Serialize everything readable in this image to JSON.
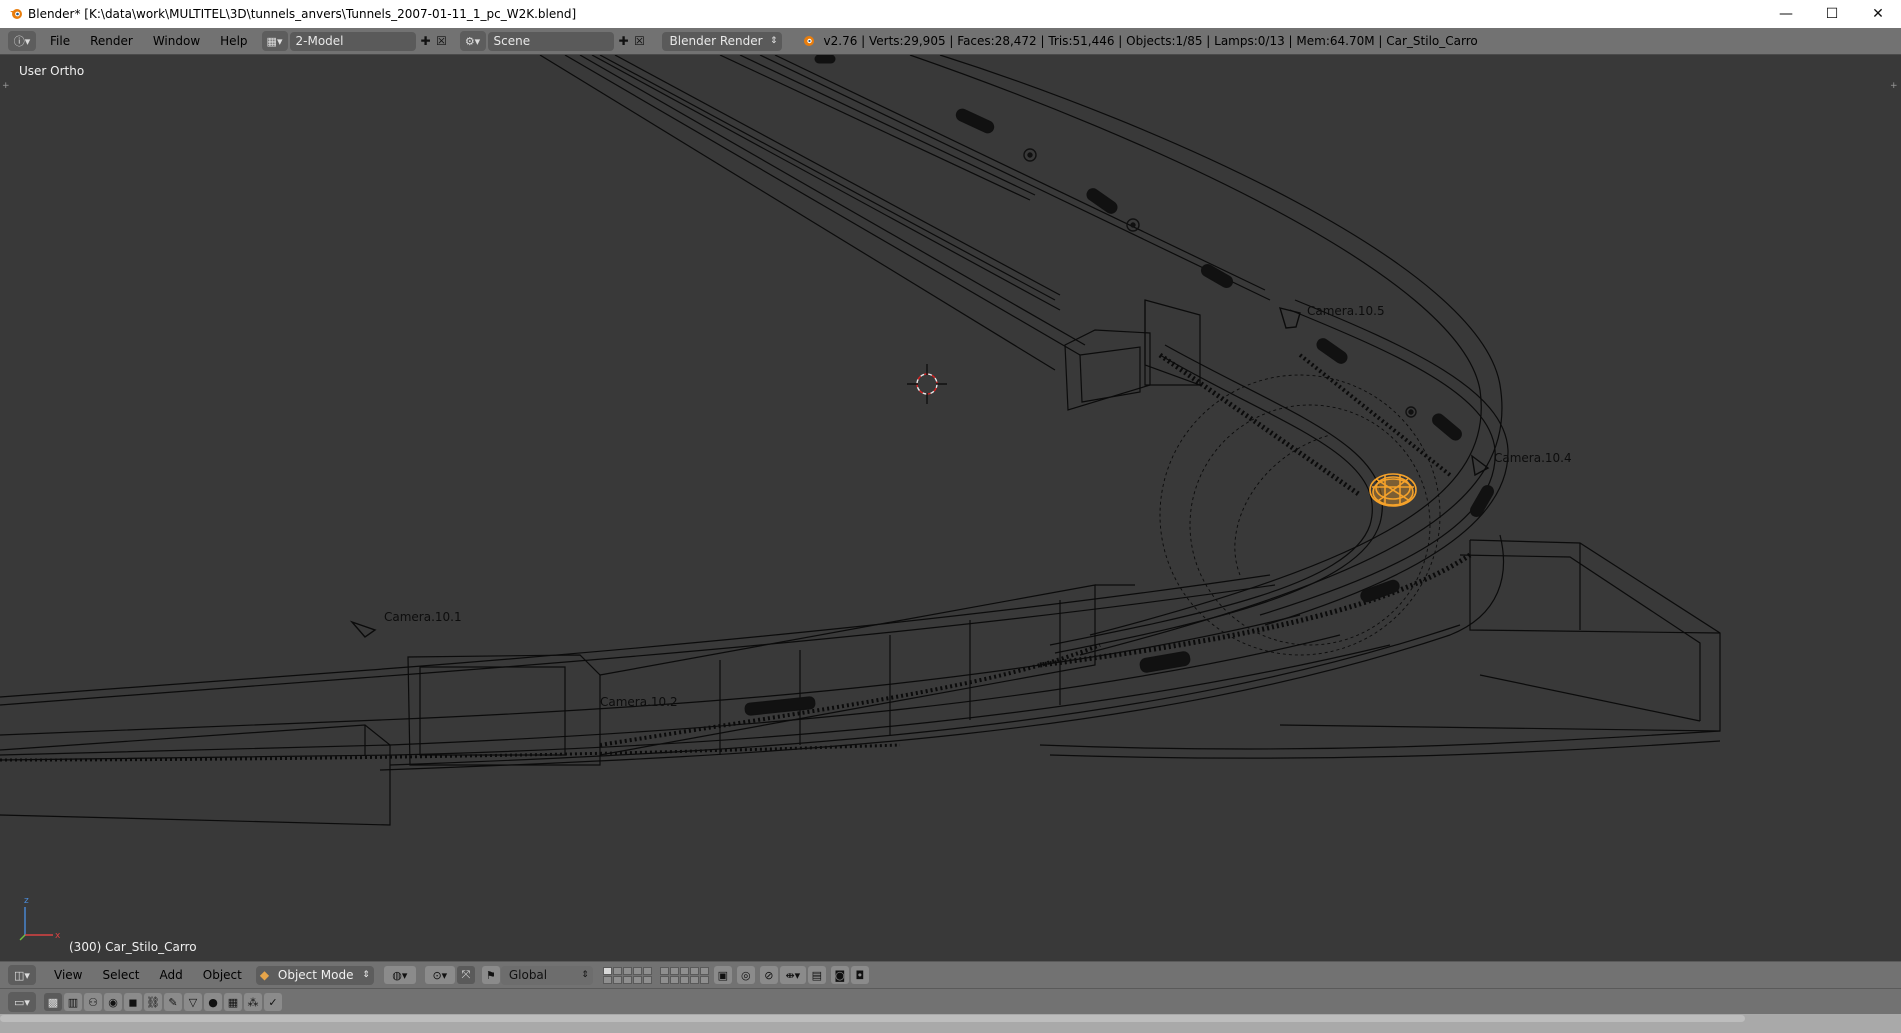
{
  "window": {
    "title": "Blender* [K:\\data\\work\\MULTITEL\\3D\\tunnels_anvers\\Tunnels_2007-01-11_1_pc_W2K.blend]",
    "controls": {
      "minimize": "—",
      "maximize": "☐",
      "close": "✕"
    }
  },
  "infobar": {
    "menus": [
      "File",
      "Render",
      "Window",
      "Help"
    ],
    "screen_layout": "2-Model",
    "scene": "Scene",
    "render_engine": "Blender Render",
    "stats": "v2.76 | Verts:29,905 | Faces:28,472 | Tris:51,446 | Objects:1/85 | Lamps:0/13 | Mem:64.70M | Car_Stilo_Carro"
  },
  "viewport": {
    "view_label": "User Ortho",
    "active_object_label": "(300) Car_Stilo_Carro",
    "cameras": [
      "Camera.10.5",
      "Camera.10.4",
      "Camera.10.1",
      "Camera.10.2"
    ],
    "axis": {
      "x": "x",
      "z": "z"
    }
  },
  "header3d": {
    "menus": [
      "View",
      "Select",
      "Add",
      "Object"
    ],
    "mode": "Object Mode",
    "orientation": "Global"
  },
  "colors": {
    "selected": "#f5a22a",
    "wire": "#0a0a0a",
    "background": "#393939",
    "header": "#727272"
  }
}
